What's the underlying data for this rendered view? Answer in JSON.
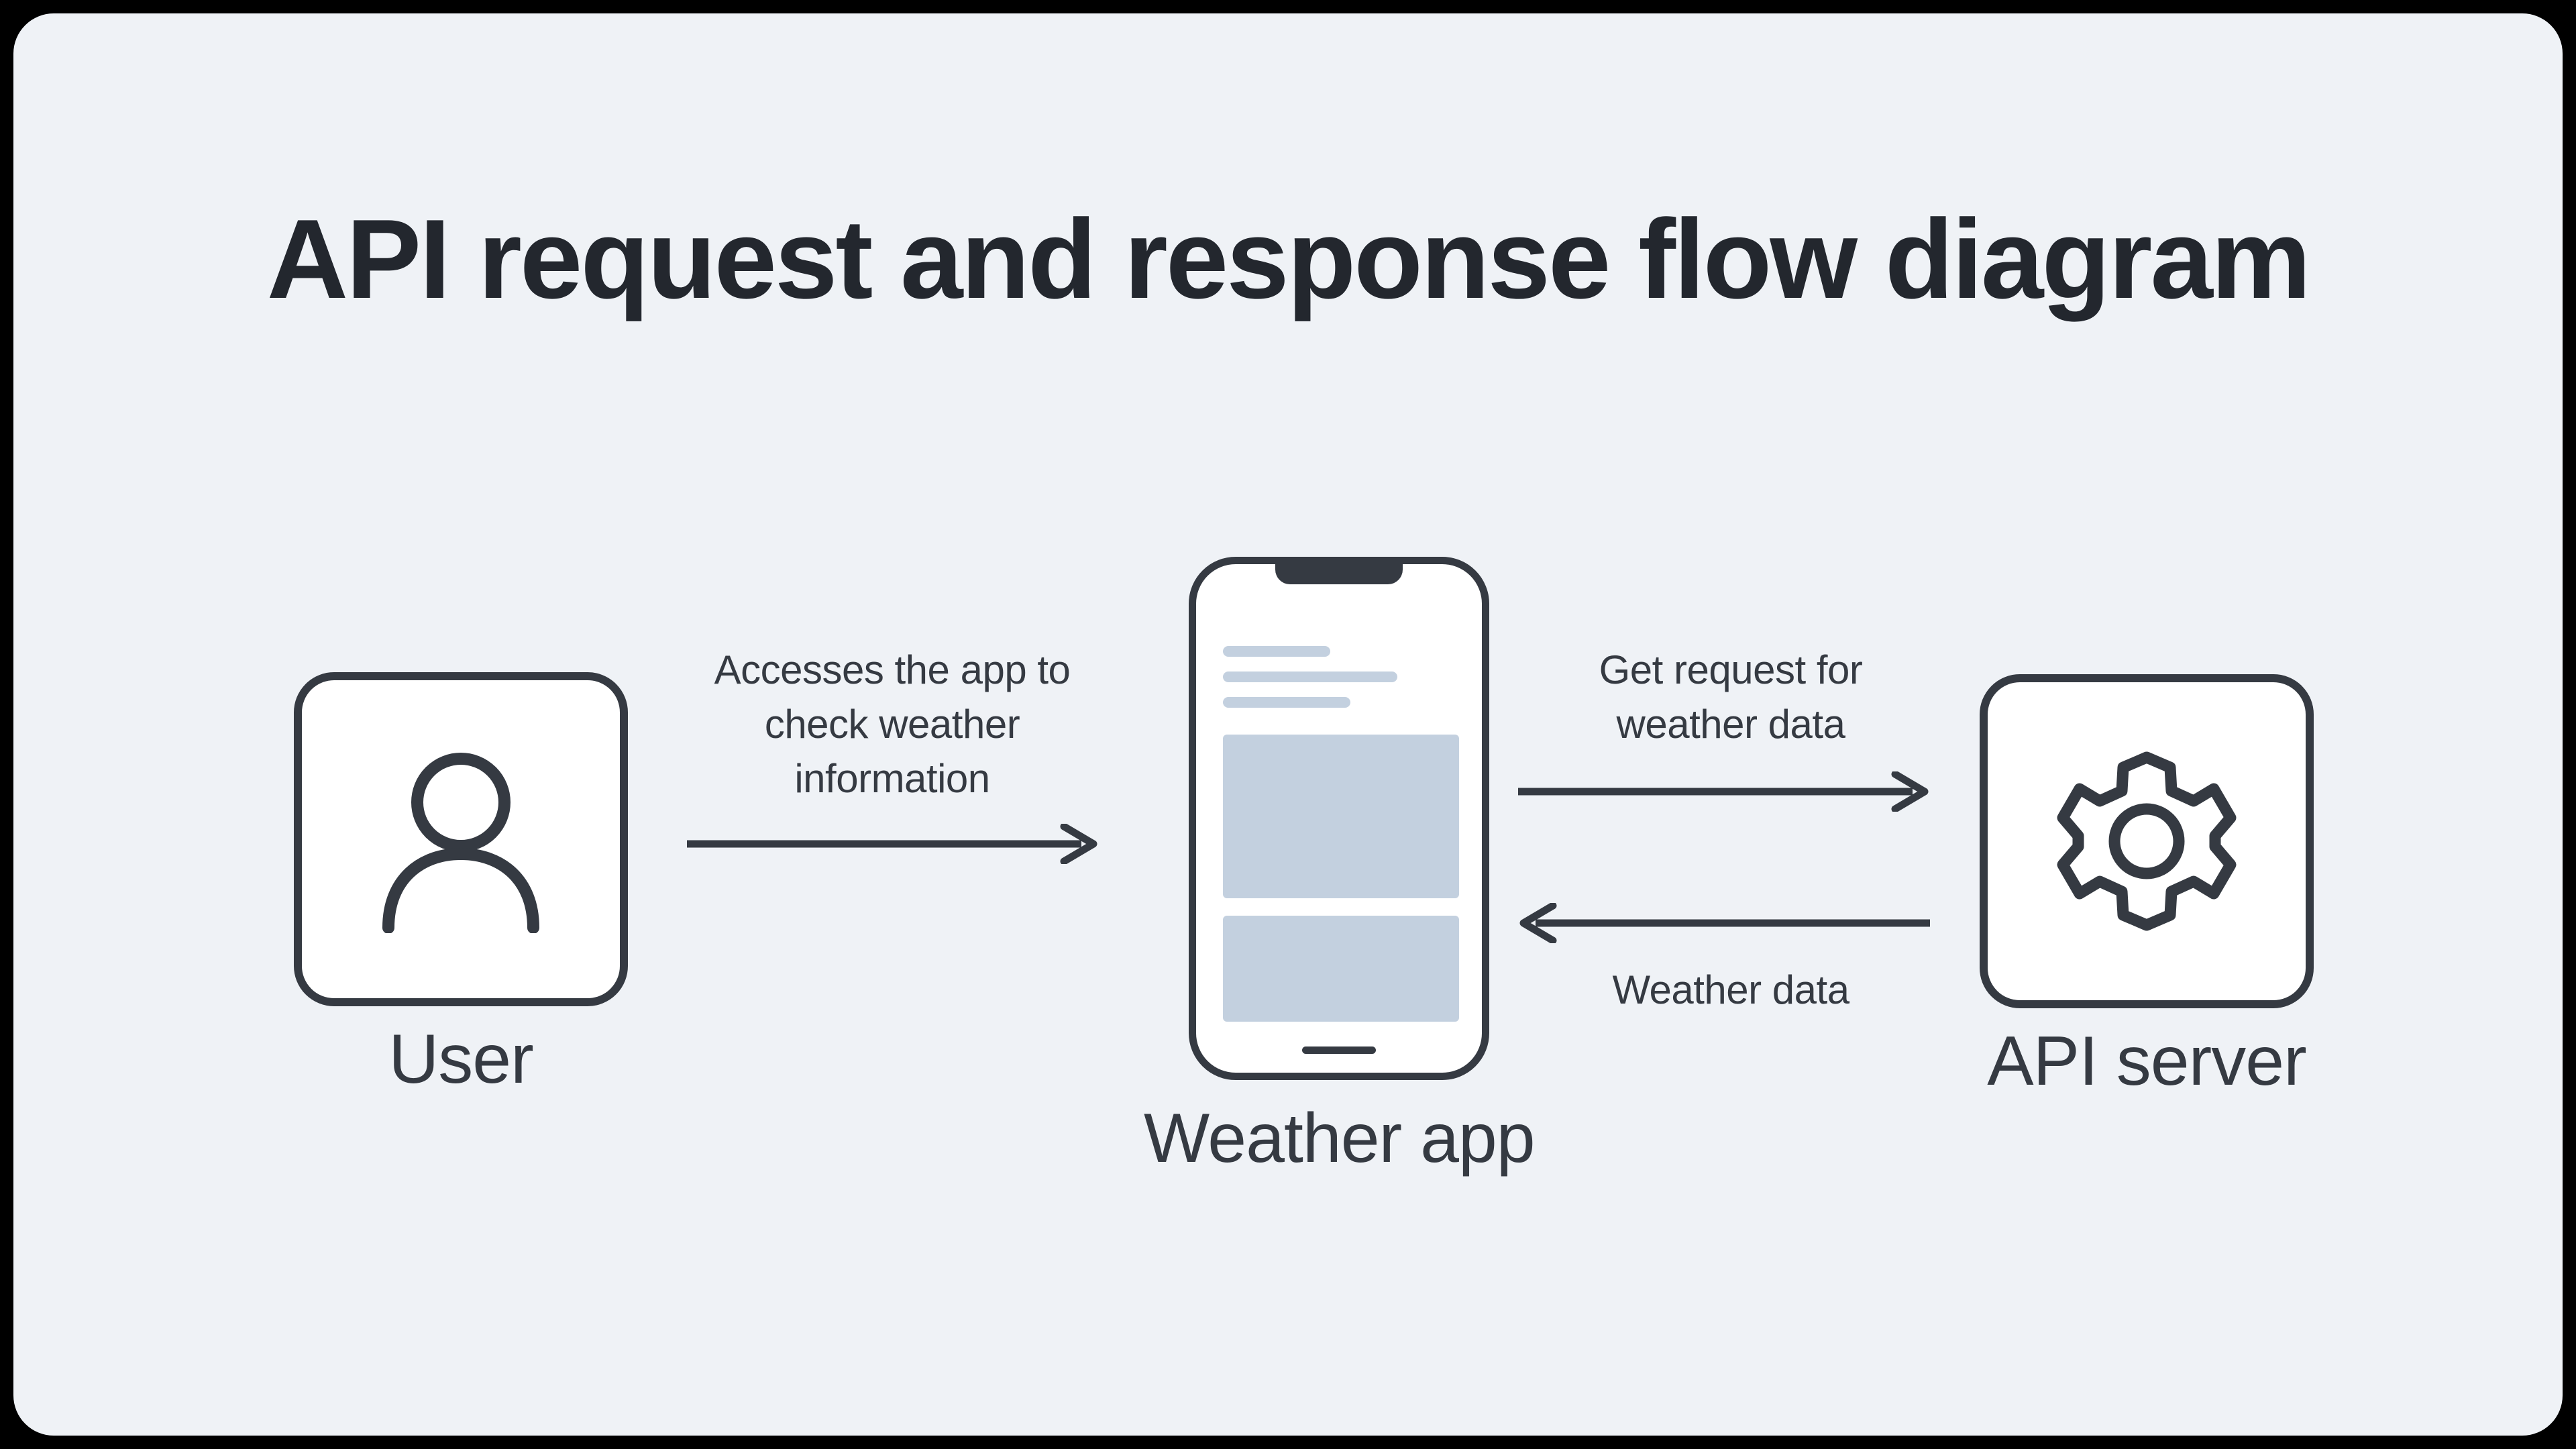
{
  "title": "API request and response flow diagram",
  "nodes": {
    "user": {
      "label": "User"
    },
    "app": {
      "label": "Weather app"
    },
    "server": {
      "label": "API server"
    }
  },
  "arrows": {
    "access": {
      "label": "Accesses the app to check weather information"
    },
    "request": {
      "label": "Get request for weather data"
    },
    "response": {
      "label": "Weather data"
    }
  },
  "colors": {
    "background": "#eff2f6",
    "stroke": "#353a42",
    "placeholder": "#c3d0df"
  }
}
